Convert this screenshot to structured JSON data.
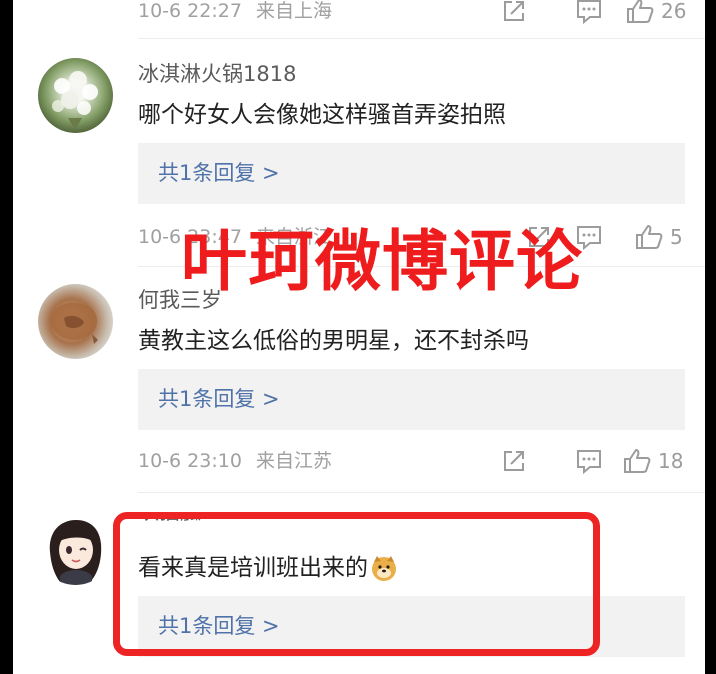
{
  "watermark": "叶珂微博评论",
  "comments": [
    {
      "username": "",
      "text": "",
      "time": "10-6 22:27",
      "source": "来自上海",
      "likes": "26"
    },
    {
      "username": "冰淇淋火锅1818",
      "text": "哪个好女人会像她这样骚首弄姿拍照",
      "reply_link": "共1条回复 >",
      "time": "10-6 23:47",
      "source": "来自浙江",
      "likes": "5"
    },
    {
      "username": "何我三岁",
      "text": "黄教主这么低俗的男明星，还不封杀吗",
      "reply_link": "共1条回复 >",
      "time": "10-6 23:10",
      "source": "来自江苏",
      "likes": "18"
    },
    {
      "username": "玖猫胍",
      "text": "看来真是培训班出来的",
      "emoji": "doge",
      "reply_link": "共1条回复 >"
    }
  ],
  "colors": {
    "watermark": "#ee1c1c",
    "highlight_border": "#ee2424",
    "reply_link": "#4f72a8"
  },
  "icons": [
    "share-icon",
    "comment-icon",
    "like-icon"
  ]
}
